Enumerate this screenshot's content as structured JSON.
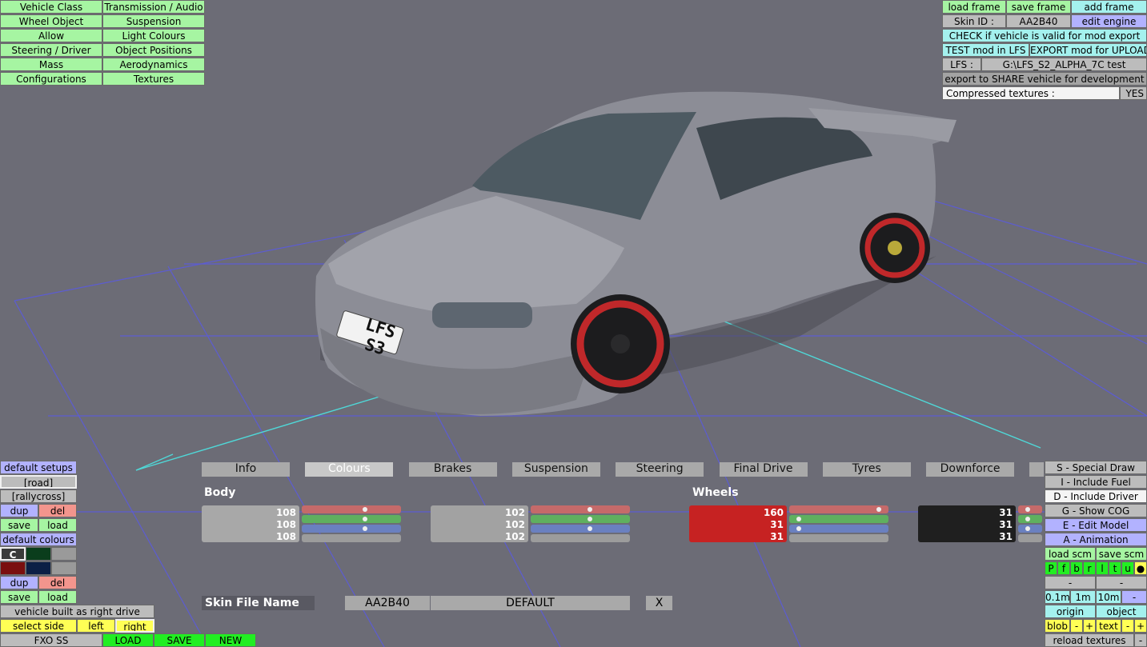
{
  "menu_left": [
    [
      "Vehicle Class",
      "Transmission / Audio"
    ],
    [
      "Wheel Object",
      "Suspension"
    ],
    [
      "Allow",
      "Light Colours"
    ],
    [
      "Steering / Driver",
      "Object Positions"
    ],
    [
      "Mass",
      "Aerodynamics"
    ],
    [
      "Configurations",
      "Textures"
    ]
  ],
  "top_right": {
    "load_frame": "load frame",
    "save_frame": "save frame",
    "add_frame": "add frame",
    "skin_id_label": "Skin ID :",
    "skin_id_value": "AA2B40",
    "edit_engine": "edit engine",
    "check_valid": "CHECK if vehicle is valid for mod export",
    "test_mod": "TEST mod in LFS",
    "export_mod": "EXPORT mod for UPLOAD",
    "lfs_label": "LFS :",
    "lfs_path": "G:\\LFS_S2_ALPHA_7C test",
    "export_share": "export to SHARE vehicle for development",
    "compressed_label": "Compressed textures :",
    "compressed_value": "YES"
  },
  "plate": "LFS S3",
  "tabs": [
    "Info",
    "Colours",
    "Brakes",
    "Suspension",
    "Steering",
    "Final Drive",
    "Tyres",
    "Downforce"
  ],
  "colours": {
    "body_label": "Body",
    "wheels_label": "Wheels",
    "body1": [
      "108",
      "108",
      "108"
    ],
    "body2": [
      "102",
      "102",
      "102"
    ],
    "wheel1": [
      "160",
      "31",
      "31"
    ],
    "wheel2": [
      "31",
      "31",
      "31"
    ],
    "body1_levels": [
      0.67,
      0.67,
      0.67
    ],
    "body2_levels": [
      0.63,
      0.63,
      0.63
    ],
    "wheel1_levels": [
      0.97,
      0.06,
      0.06
    ],
    "wheel2_levels": [
      0.06,
      0.06,
      0.06
    ]
  },
  "skin": {
    "label": "Skin File Name",
    "id": "AA2B40",
    "name": "DEFAULT",
    "close": "X"
  },
  "bottom_left": {
    "default_setups": "default setups",
    "road": "[road]",
    "rallycross": "[rallycross]",
    "dup": "dup",
    "del": "del",
    "save": "save",
    "load": "load",
    "default_colours": "default colours",
    "c_label": "C",
    "right_drive": "vehicle built as right drive",
    "select_side": "select side",
    "left": "left",
    "right": "right",
    "fxo": "FXO SS",
    "LOAD": "LOAD",
    "SAVE": "SAVE",
    "NEW": "NEW"
  },
  "bottom_right": {
    "special_draw": "S - Special Draw",
    "include_fuel": "I - Include Fuel",
    "include_driver": "D - Include Driver",
    "show_cog": "G - Show COG",
    "edit_model": "E - Edit Model",
    "animation": "A - Animation",
    "load_scm": "load scm",
    "save_scm": "save scm",
    "letters": [
      "P",
      "f",
      "b",
      "r",
      "l",
      "t",
      "u",
      "●"
    ],
    "minus": "-",
    "m01": "0.1m",
    "m1": "1m",
    "m10": "10m",
    "origin": "origin",
    "object": "object",
    "blob": "blob",
    "plus": "+",
    "text": "text",
    "reload_textures": "reload textures"
  },
  "swatches": [
    "#1f1f1f",
    "#0a3d1c",
    "#9a9a9a",
    "#7a0f0f",
    "#0c1f45",
    "#9a9a9a"
  ]
}
